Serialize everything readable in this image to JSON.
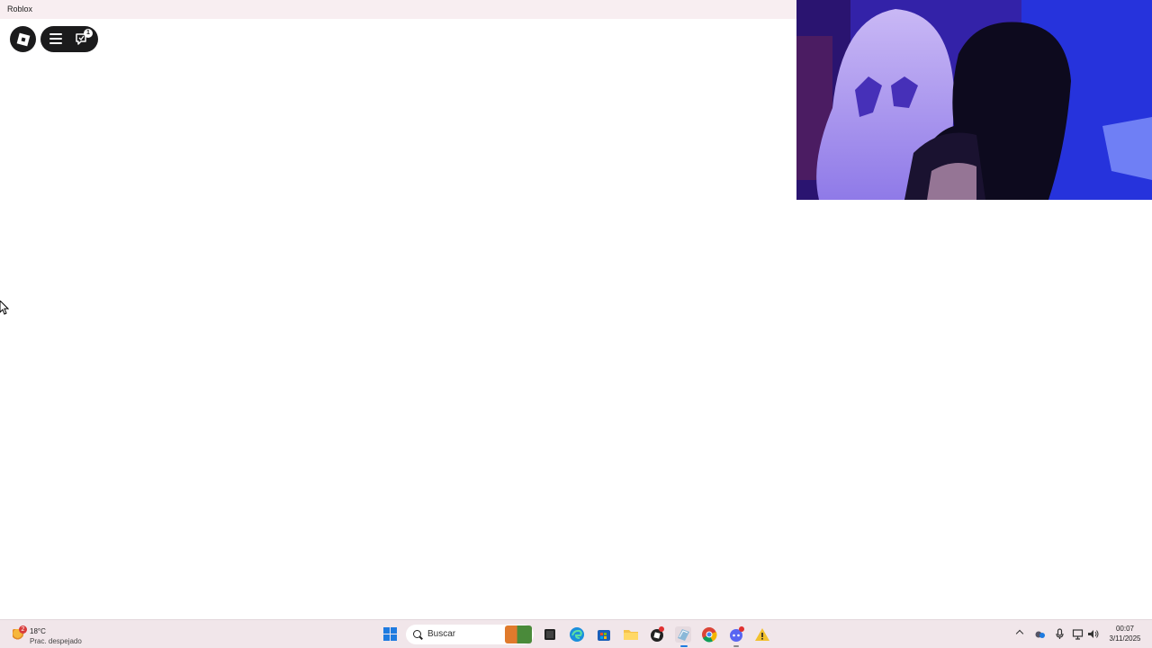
{
  "window": {
    "title": "Roblox"
  },
  "roblox_toolbar": {
    "chat_badge_count": "1"
  },
  "taskbar": {
    "weather": {
      "badge": "2",
      "temperature": "18°C",
      "description": "Prac. despejado"
    },
    "search": {
      "placeholder": "Buscar"
    },
    "pinned_apps": [
      "task-view-icon",
      "edge-icon",
      "store-icon",
      "file-explorer-icon",
      "roblox-studio-icon",
      "roblox-player-icon",
      "chrome-icon",
      "discord-icon",
      "warning-icon"
    ],
    "tray": {
      "time": "00:07",
      "date": "3/11/2025"
    }
  },
  "colors": {
    "taskbar_bg": "#f1e6ea",
    "titlebar_bg": "#f8eef1",
    "roblox_dark": "#1b1b1c",
    "windows_blue": "#1f7be0"
  }
}
